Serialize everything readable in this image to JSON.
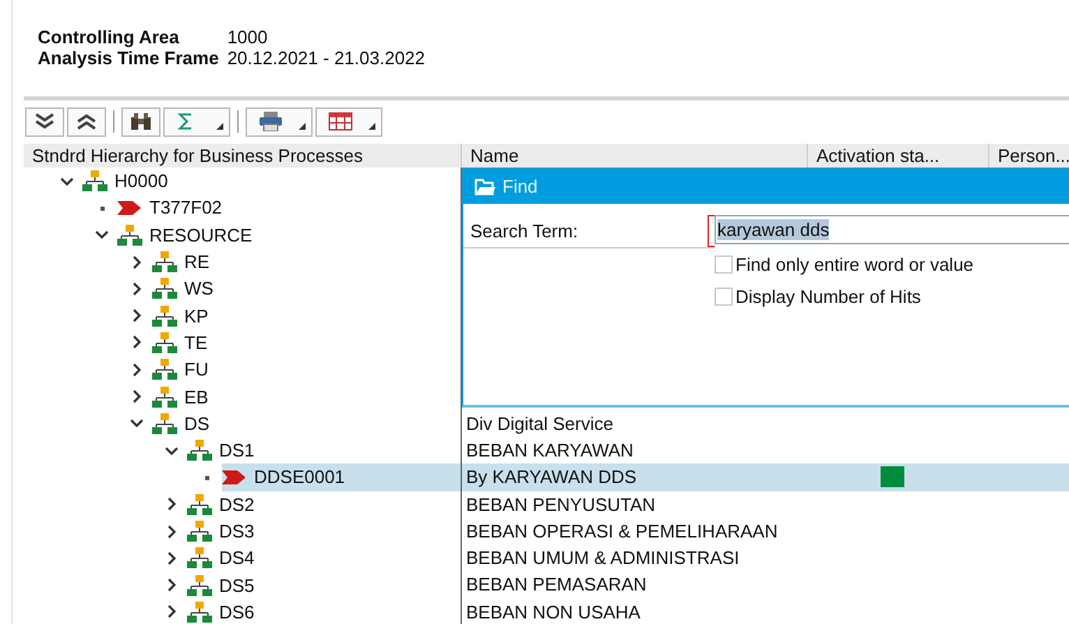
{
  "header": [
    {
      "label": "Controlling Area",
      "value": "1000"
    },
    {
      "label": "Analysis Time Frame",
      "value": "20.12.2021 - 21.03.2022"
    }
  ],
  "toolbar": [
    {
      "kind": "expand-all"
    },
    {
      "kind": "collapse-all"
    },
    {
      "kind": "separator"
    },
    {
      "kind": "find"
    },
    {
      "kind": "sum",
      "dropdown": true
    },
    {
      "kind": "separator"
    },
    {
      "kind": "print",
      "dropdown": true
    },
    {
      "kind": "layout",
      "dropdown": true
    }
  ],
  "table": {
    "columns": [
      "Stndrd Hierarchy for Business Processes",
      "Name",
      "Activation sta...",
      "Person..."
    ],
    "tree": [
      {
        "label": "H0000",
        "kind": "group",
        "expanded": true,
        "selected": false,
        "children": [
          {
            "label": "T377F02",
            "kind": "process",
            "selected": false
          },
          {
            "label": "RESOURCE",
            "kind": "group",
            "expanded": true,
            "selected": false,
            "children": [
              {
                "label": "RE",
                "kind": "group",
                "expanded": false,
                "selected": false
              },
              {
                "label": "WS",
                "kind": "group",
                "expanded": false,
                "selected": false
              },
              {
                "label": "KP",
                "kind": "group",
                "expanded": false,
                "selected": false
              },
              {
                "label": "TE",
                "kind": "group",
                "expanded": false,
                "selected": false
              },
              {
                "label": "FU",
                "kind": "group",
                "expanded": false,
                "selected": false
              },
              {
                "label": "EB",
                "kind": "group",
                "expanded": false,
                "selected": false
              },
              {
                "label": "DS",
                "kind": "group",
                "expanded": true,
                "selected": false,
                "name": "Div Digital Service",
                "children": [
                  {
                    "label": "DS1",
                    "kind": "group",
                    "expanded": true,
                    "selected": false,
                    "name": "BEBAN KARYAWAN",
                    "children": [
                      {
                        "label": "DDSE0001",
                        "kind": "process",
                        "selected": true,
                        "name": "By KARYAWAN DDS",
                        "color": "#008c3c"
                      }
                    ]
                  },
                  {
                    "label": "DS2",
                    "kind": "group",
                    "expanded": false,
                    "selected": false,
                    "name": "BEBAN PENYUSUTAN"
                  },
                  {
                    "label": "DS3",
                    "kind": "group",
                    "expanded": false,
                    "selected": false,
                    "name": "BEBAN OPERASI & PEMELIHARAAN"
                  },
                  {
                    "label": "DS4",
                    "kind": "group",
                    "expanded": false,
                    "selected": false,
                    "name": "BEBAN UMUM & ADMINISTRASI"
                  },
                  {
                    "label": "DS5",
                    "kind": "group",
                    "expanded": false,
                    "selected": false,
                    "name": "BEBAN PEMASARAN"
                  },
                  {
                    "label": "DS6",
                    "kind": "group",
                    "expanded": false,
                    "selected": false,
                    "name": "BEBAN NON USAHA"
                  }
                ]
              }
            ]
          }
        ]
      }
    ]
  },
  "find_dialog": {
    "title": "Find",
    "search_label": "Search Term:",
    "search_value": "karyawan dds",
    "options": [
      {
        "label": "Find only entire word or value",
        "checked": false
      },
      {
        "label": "Display Number of Hits",
        "checked": false
      }
    ]
  }
}
